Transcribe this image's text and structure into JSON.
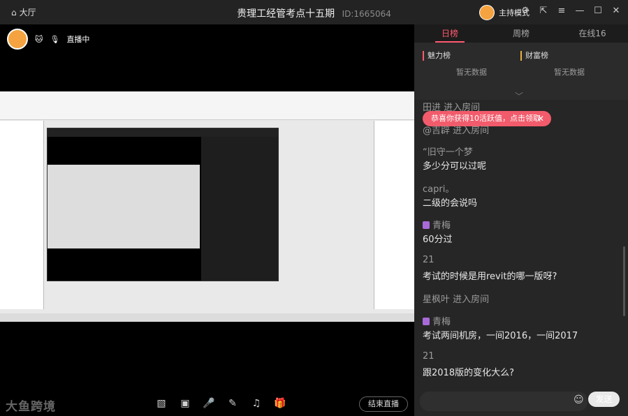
{
  "window": {
    "back_label": "大厅",
    "title": "贵理工经管考点十五期",
    "room_id": "ID:1665064",
    "host_mode": "主持模式"
  },
  "video": {
    "live_status": "直播中",
    "brand": "大鱼跨境",
    "end_live": "结束直播"
  },
  "panel": {
    "tabs": [
      "日榜",
      "周榜",
      "在线16"
    ],
    "charm_rank": "魅力榜",
    "wealth_rank": "财富榜",
    "no_data": "暂无数据",
    "toast": "恭喜你获得10活跃值，点击领取"
  },
  "chat": [
    {
      "type": "system",
      "text": "田进 进入房间"
    },
    {
      "type": "system",
      "text": "@吉辟 进入房间"
    },
    {
      "type": "msg",
      "name": "“旧守一个梦",
      "text": "多少分可以过呢"
    },
    {
      "type": "msg",
      "name": "capri。",
      "text": "二级的会说吗"
    },
    {
      "type": "msg",
      "name": "青梅",
      "role": true,
      "text": "60分过"
    },
    {
      "type": "msg",
      "name": "21",
      "text": "考试的时候是用revit的哪一版呀?"
    },
    {
      "type": "system",
      "text": "星枫叶 进入房间"
    },
    {
      "type": "msg",
      "name": "青梅",
      "role": true,
      "text": "考试两间机房，一间2016，一间2017"
    },
    {
      "type": "msg",
      "name": "21",
      "text": "跟2018版的变化大么?"
    }
  ],
  "input": {
    "send_label": "发送"
  },
  "colors": {
    "accent": "#ff5a6e",
    "toast": "#f25b6b",
    "gift": "#ff7a3d"
  }
}
